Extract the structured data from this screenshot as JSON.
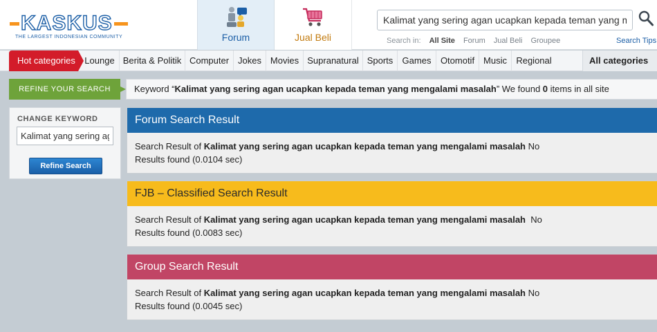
{
  "logo": {
    "word": "KASKUS",
    "tagline": "THE LARGEST INDONESIAN COMMUNITY"
  },
  "nav": {
    "forum_label": "Forum",
    "jual_beli_label": "Jual Beli"
  },
  "search": {
    "value": "Kalimat yang sering agan ucapkan kepada teman yang mengalami masalah",
    "search_in_label": "Search in:",
    "options": [
      "All Site",
      "Forum",
      "Jual Beli",
      "Groupee"
    ],
    "tips_label": "Search Tips"
  },
  "categories": {
    "hot_label": "Hot categories",
    "items": [
      "Lounge",
      "Berita & Politik",
      "Computer",
      "Jokes",
      "Movies",
      "Supranatural",
      "Sports",
      "Games",
      "Otomotif",
      "Music",
      "Regional"
    ],
    "all_label": "All categories"
  },
  "refine": {
    "tab_label": "REFINE YOUR SEARCH",
    "kw_prefix": "Keyword “",
    "kw_text": "Kalimat yang sering agan ucapkan kepada teman yang mengalami masalah",
    "kw_mid": "” We found ",
    "kw_count": "0",
    "kw_suffix": " items in all site"
  },
  "sidebar": {
    "title": "CHANGE KEYWORD",
    "input_value": "Kalimat yang sering agan ucapkan kepada teman yang mengalami masalah",
    "button_label": "Refine Search"
  },
  "results": {
    "forum": {
      "title": "Forum Search Result",
      "prefix": "Search Result of ",
      "query": "Kalimat yang sering agan ucapkan kepada teman yang mengalami masalah",
      "suffix": " No",
      "line2": "Results found (0.0104 sec)"
    },
    "fjb": {
      "title": "FJB – Classified Search Result",
      "prefix": "Search Result of ",
      "query": "Kalimat yang sering agan ucapkan kepada teman yang mengalami masalah",
      "suffix": "  No",
      "line2": "Results found (0.0083 sec)"
    },
    "group": {
      "title": "Group Search Result",
      "prefix": "Search Result of ",
      "query": "Kalimat yang sering agan ucapkan kepada teman yang mengalami masalah",
      "suffix": " No",
      "line2": "Results found (0.0045 sec)"
    }
  },
  "colors": {
    "brand_blue": "#1e6aab",
    "hot_red": "#d31c2a",
    "refine_green": "#6ea33a",
    "fjb_yellow": "#f7bb1c",
    "group_pink": "#c14565"
  },
  "icons": {
    "forum": "forum-figures-icon",
    "jual_beli": "shopping-cart-icon",
    "search": "magnifier-icon"
  }
}
